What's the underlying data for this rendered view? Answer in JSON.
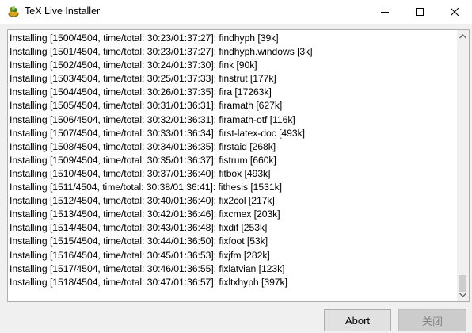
{
  "window": {
    "title": "TeX Live Installer",
    "controls": {
      "minimize": "minimize-icon",
      "maximize": "maximize-icon",
      "close": "close-icon"
    }
  },
  "log": {
    "lines": [
      "Installing [1500/4504, time/total: 30:23/01:37:27]: findhyph [39k]",
      "Installing [1501/4504, time/total: 30:23/01:37:27]: findhyph.windows [3k]",
      "Installing [1502/4504, time/total: 30:24/01:37:30]: fink [90k]",
      "Installing [1503/4504, time/total: 30:25/01:37:33]: finstrut [177k]",
      "Installing [1504/4504, time/total: 30:26/01:37:35]: fira [17263k]",
      "Installing [1505/4504, time/total: 30:31/01:36:31]: firamath [627k]",
      "Installing [1506/4504, time/total: 30:32/01:36:31]: firamath-otf [116k]",
      "Installing [1507/4504, time/total: 30:33/01:36:34]: first-latex-doc [493k]",
      "Installing [1508/4504, time/total: 30:34/01:36:35]: firstaid [268k]",
      "Installing [1509/4504, time/total: 30:35/01:36:37]: fistrum [660k]",
      "Installing [1510/4504, time/total: 30:37/01:36:40]: fitbox [493k]",
      "Installing [1511/4504, time/total: 30:38/01:36:41]: fithesis [1531k]",
      "Installing [1512/4504, time/total: 30:40/01:36:40]: fix2col [217k]",
      "Installing [1513/4504, time/total: 30:42/01:36:46]: fixcmex [203k]",
      "Installing [1514/4504, time/total: 30:43/01:36:48]: fixdif [253k]",
      "Installing [1515/4504, time/total: 30:44/01:36:50]: fixfoot [53k]",
      "Installing [1516/4504, time/total: 30:45/01:36:53]: fixjfm [282k]",
      "Installing [1517/4504, time/total: 30:46/01:36:55]: fixlatvian [123k]",
      "Installing [1518/4504, time/total: 30:47/01:36:57]: fixltxhyph [397k]"
    ]
  },
  "buttons": {
    "abort": "Abort",
    "close": "关闭"
  }
}
